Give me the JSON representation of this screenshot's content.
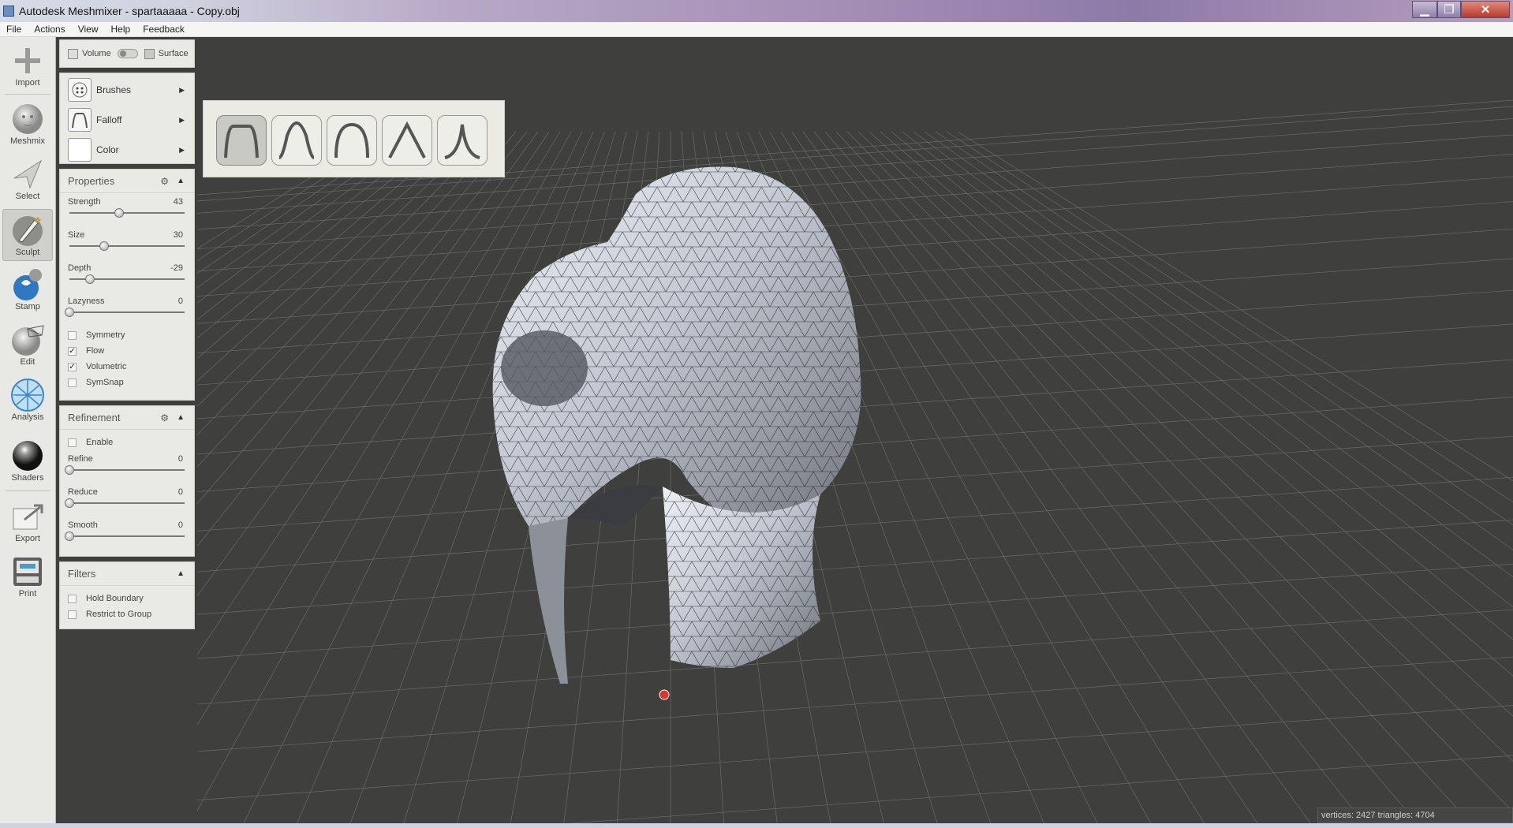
{
  "window": {
    "title": "Autodesk Meshmixer - spartaaaaa - Copy.obj",
    "minimize": "▁",
    "maximize": "❐",
    "close": "✕"
  },
  "menu": [
    "File",
    "Actions",
    "View",
    "Help",
    "Feedback"
  ],
  "tools": [
    {
      "label": "Import",
      "icon": "plus-icon"
    },
    {
      "label": "Meshmix",
      "icon": "bust-icon"
    },
    {
      "label": "Select",
      "icon": "arrow-icon"
    },
    {
      "label": "Sculpt",
      "icon": "brush-icon"
    },
    {
      "label": "Stamp",
      "icon": "stamp-icon"
    },
    {
      "label": "Edit",
      "icon": "edit-icon"
    },
    {
      "label": "Analysis",
      "icon": "sphere-mesh-icon"
    },
    {
      "label": "Shaders",
      "icon": "shader-ball-icon"
    },
    {
      "label": "Export",
      "icon": "export-icon"
    },
    {
      "label": "Print",
      "icon": "printer-icon"
    }
  ],
  "mode": {
    "volume": "Volume",
    "surface": "Surface"
  },
  "brush_panel": {
    "brushes": "Brushes",
    "falloff": "Falloff",
    "color": "Color"
  },
  "properties": {
    "title": "Properties",
    "sliders": [
      {
        "label": "Strength",
        "value": "43",
        "fraction": 0.43
      },
      {
        "label": "Size",
        "value": "30",
        "fraction": 0.3
      },
      {
        "label": "Depth",
        "value": "-29",
        "fraction": 0.18
      },
      {
        "label": "Lazyness",
        "value": "0",
        "fraction": 0.0
      }
    ],
    "checks": [
      {
        "label": "Symmetry",
        "checked": false
      },
      {
        "label": "Flow",
        "checked": true
      },
      {
        "label": "Volumetric",
        "checked": true
      },
      {
        "label": "SymSnap",
        "checked": false
      }
    ]
  },
  "refinement": {
    "title": "Refinement",
    "enable": "Enable",
    "sliders": [
      {
        "label": "Refine",
        "value": "0",
        "fraction": 0
      },
      {
        "label": "Reduce",
        "value": "0",
        "fraction": 0
      },
      {
        "label": "Smooth",
        "value": "0",
        "fraction": 0
      }
    ]
  },
  "filters": {
    "title": "Filters",
    "hold_boundary": "Hold Boundary",
    "restrict_group": "Restrict to Group"
  },
  "falloff_options": [
    "flat-falloff-icon",
    "smooth-falloff-icon",
    "round-falloff-icon",
    "linear-falloff-icon",
    "sharp-falloff-icon"
  ],
  "status": "vertices: 2427 triangles: 4704",
  "colors": {
    "viewport_bg": "#3f3f3d",
    "grid": "#6a6a68",
    "mesh": "#c9cdd6",
    "pivot": "#e0352f"
  }
}
